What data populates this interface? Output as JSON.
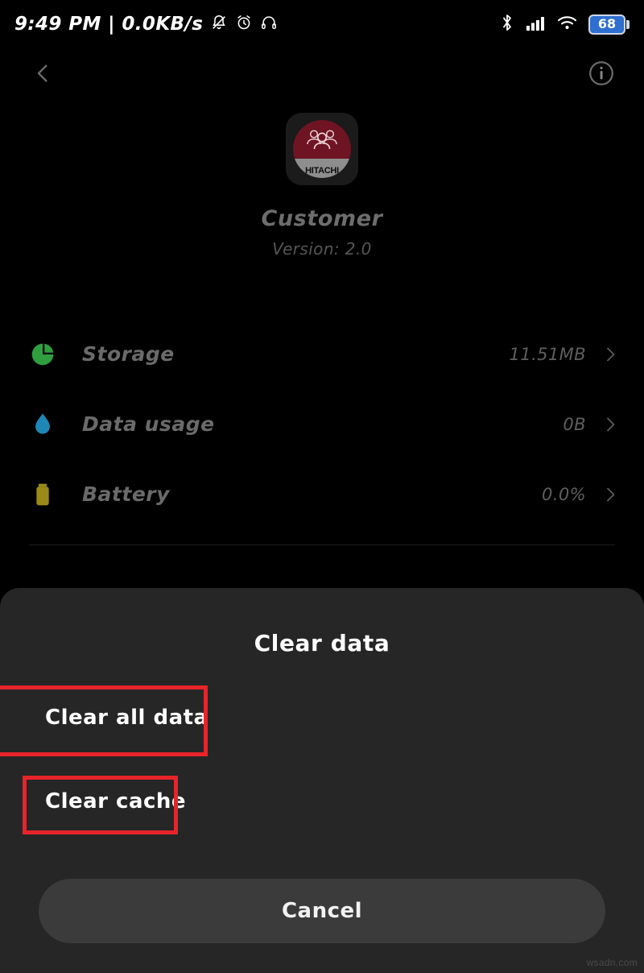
{
  "status_bar": {
    "clock_and_net": "9:49 PM | 0.0KB/s",
    "icons_left": [
      "notification-muted-icon",
      "alarm-icon",
      "headphones-icon"
    ],
    "icons_right": [
      "bluetooth-icon",
      "signal-icon",
      "wifi-icon"
    ],
    "battery_percent": "68"
  },
  "app_bar": {
    "back_icon": "back-chevron-icon",
    "info_icon": "info-circle-icon"
  },
  "app_header": {
    "icon_name": "customer-app-icon",
    "icon_word": "HITACHI",
    "name": "Customer",
    "version": "Version: 2.0"
  },
  "rows": [
    {
      "icon": "pie-chart-icon",
      "icon_color": "#2e9e3e",
      "label": "Storage",
      "value": "11.51MB"
    },
    {
      "icon": "water-drop-icon",
      "icon_color": "#1e87b5",
      "label": "Data usage",
      "value": "0B"
    },
    {
      "icon": "battery-icon",
      "icon_color": "#9a8b18",
      "label": "Battery",
      "value": "0.0%"
    }
  ],
  "hidden_row": {
    "label": "",
    "value": ""
  },
  "sheet": {
    "title": "Clear data",
    "options": [
      {
        "label": "Clear all data",
        "highlighted": true
      },
      {
        "label": "Clear cache",
        "highlighted": true
      }
    ],
    "cancel_label": "Cancel"
  },
  "annotations": {
    "color": "#e8232a"
  },
  "watermark": "wsadn.com"
}
